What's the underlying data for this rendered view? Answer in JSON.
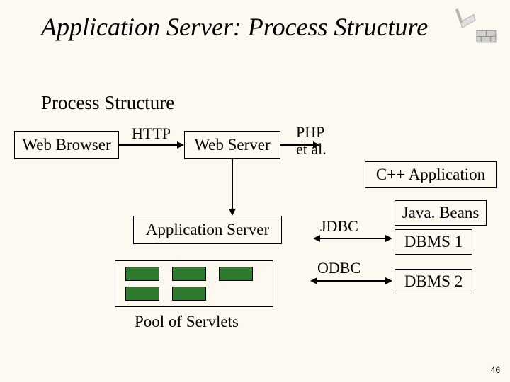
{
  "title": "Application Server: Process Structure",
  "subtitle": "Process Structure",
  "nodes": {
    "web_browser": "Web Browser",
    "web_server": "Web Server",
    "cpp_app": "C++ Application",
    "app_server": "Application Server",
    "java_beans": "Java. Beans",
    "dbms1": "DBMS 1",
    "dbms2": "DBMS 2",
    "pool": "Pool of Servlets"
  },
  "edges": {
    "http": "HTTP",
    "php": "PHP et al.",
    "jdbc": "JDBC",
    "odbc": "ODBC"
  },
  "page_number": "46"
}
